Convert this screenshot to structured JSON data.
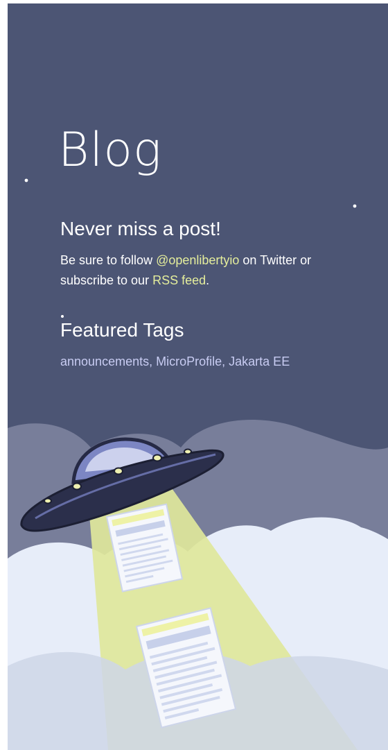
{
  "page": {
    "title": "Blog"
  },
  "never_miss": {
    "heading": "Never miss a post!",
    "line_prefix": "Be sure to follow ",
    "twitter_handle": "@openlibertyio",
    "line_middle": " on Twitter or subscribe to our ",
    "rss_link": "RSS feed",
    "line_suffix": "."
  },
  "featured_tags": {
    "heading": "Featured Tags",
    "tags": [
      "announcements",
      "MicroProfile",
      "Jakarta EE"
    ],
    "separator": ", "
  },
  "colors": {
    "background": "#4c5574",
    "link": "#e5ee9c",
    "tag_link": "#c8ccf2",
    "heading": "#ffffff"
  },
  "illustration": {
    "icons": [
      "ufo-icon",
      "tractor-beam",
      "document-icon",
      "cloud-icon",
      "star-icon"
    ]
  }
}
